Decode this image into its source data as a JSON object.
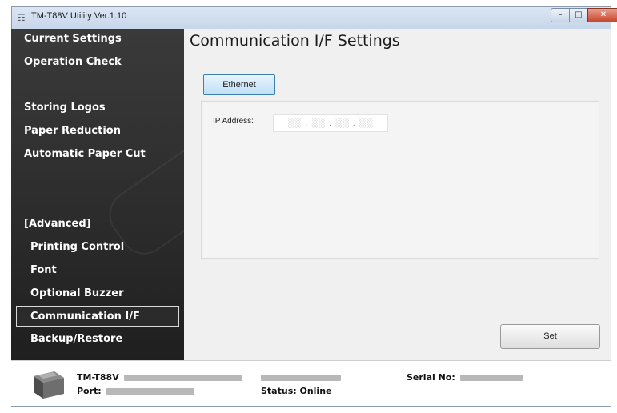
{
  "window": {
    "title": "TM-T88V Utility Ver.1.10",
    "min_glyph": "–",
    "max_glyph": "□",
    "close_glyph": "✕"
  },
  "sidebar": {
    "items": [
      {
        "label": "Current Settings"
      },
      {
        "label": "Operation Check"
      },
      {
        "label": "Storing Logos"
      },
      {
        "label": "Paper Reduction"
      },
      {
        "label": "Automatic Paper Cut"
      },
      {
        "label": "[Advanced]"
      },
      {
        "label": "Printing Control"
      },
      {
        "label": "Font"
      },
      {
        "label": "Optional Buzzer"
      },
      {
        "label": "Communication I/F"
      },
      {
        "label": "Backup/Restore"
      }
    ],
    "selected": "Communication I/F"
  },
  "main": {
    "title": "Communication I/F Settings",
    "tab_label": "Ethernet",
    "ip_label": "IP Address:",
    "ip_value": "░░ . ░░ . ░░ . ░░",
    "set_label": "Set"
  },
  "status": {
    "model_label": "TM-T88V",
    "port_label": "Port:",
    "status_text": "Status: Online",
    "serial_label": "Serial No:"
  },
  "colors": {
    "sidebar_bg": "#2b2b2b",
    "tab_border": "#3c7fb1",
    "close_red": "#c8452b"
  },
  "icons": {
    "app": "printer-app-icon",
    "printer": "receipt-printer-icon"
  }
}
